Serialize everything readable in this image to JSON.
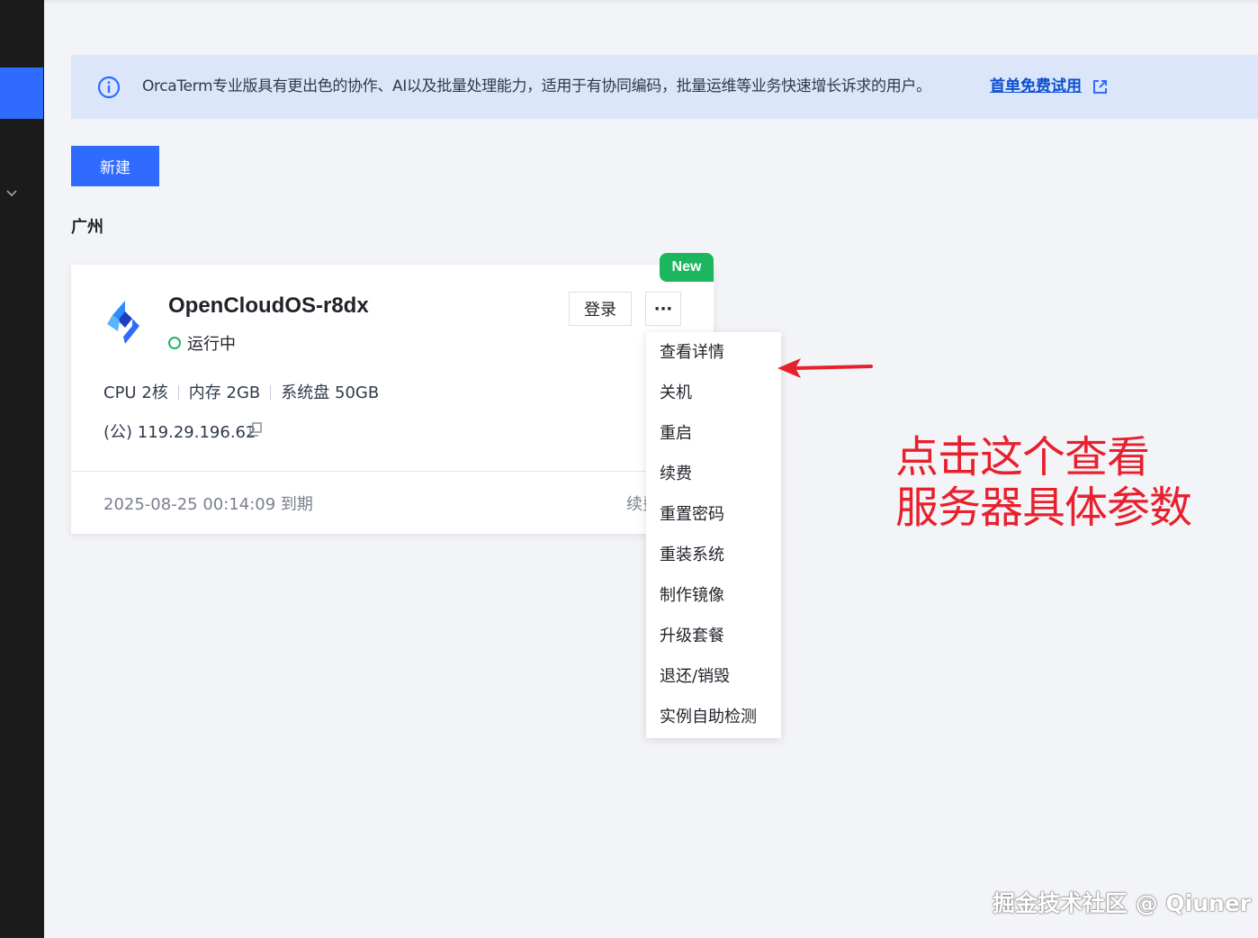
{
  "notice": {
    "text": "OrcaTerm专业版具有更出色的协作、AI以及批量处理能力，适用于有协同编码，批量运维等业务快速增长诉求的用户。",
    "link": "首单免费试用"
  },
  "toolbar": {
    "new_label": "新建"
  },
  "region": "广州",
  "instance": {
    "badge": "New",
    "name": "OpenCloudOS-r8dx",
    "status": "运行中",
    "login_label": "登录",
    "more_label": "···",
    "cpu": "CPU 2核",
    "memory": "内存 2GB",
    "disk": "系统盘 50GB",
    "ip": "(公) 119.29.196.62",
    "expire": "2025-08-25 00:14:09 到期",
    "renew": "续费"
  },
  "menu": {
    "items": [
      "查看详情",
      "关机",
      "重启",
      "续费",
      "重置密码",
      "重装系统",
      "制作镜像",
      "升级套餐",
      "退还/销毁",
      "实例自助检测"
    ]
  },
  "annotation": {
    "line1": "点击这个查看",
    "line2": "服务器具体参数"
  },
  "watermark": "掘金技术社区 @ Qiuner",
  "colors": {
    "primary": "#2f6bff",
    "success": "#1cb65e",
    "annotation": "#e8202e",
    "notice_bg": "#dbe6fb"
  },
  "icons": [
    "info-icon",
    "external-link-icon",
    "chevron-down-icon",
    "copy-icon",
    "arrow-icon",
    "logo-icon"
  ]
}
